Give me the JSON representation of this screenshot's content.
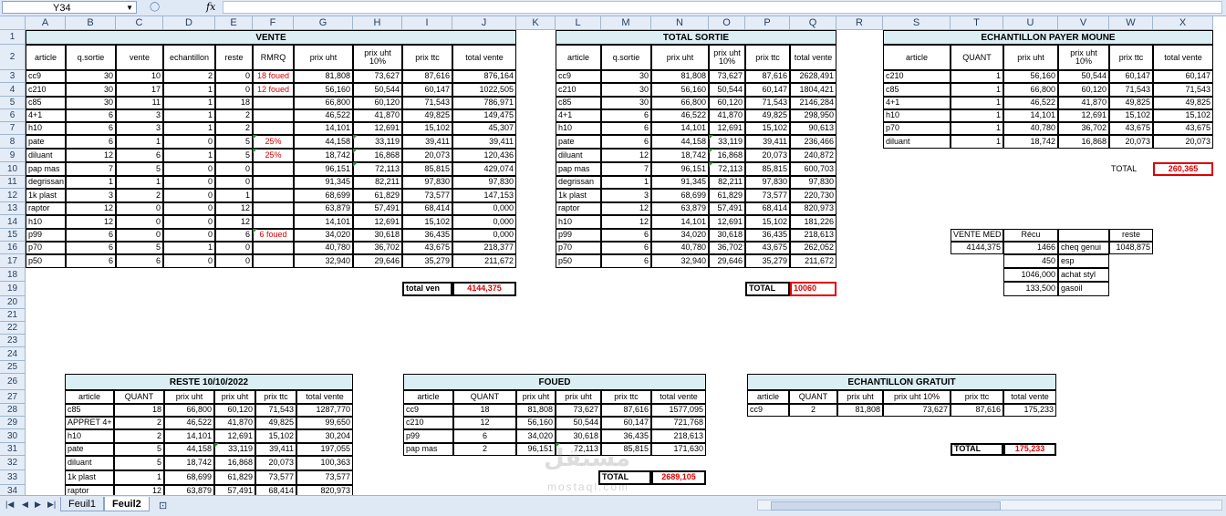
{
  "formula_bar": {
    "name_box": "Y34",
    "fx": "fx"
  },
  "columns": [
    "A",
    "B",
    "C",
    "D",
    "E",
    "F",
    "G",
    "H",
    "I",
    "J",
    "K",
    "L",
    "M",
    "N",
    "O",
    "P",
    "Q",
    "R",
    "S",
    "T",
    "U",
    "V",
    "W",
    "X"
  ],
  "rows": [
    "1",
    "2",
    "3",
    "4",
    "5",
    "6",
    "7",
    "8",
    "9",
    "10",
    "11",
    "12",
    "13",
    "14",
    "15",
    "16",
    "17",
    "18",
    "19",
    "20",
    "21",
    "22",
    "23",
    "24",
    "25",
    "26",
    "27",
    "28",
    "29",
    "30",
    "31",
    "32",
    "33",
    "34"
  ],
  "vente": {
    "title": "VENTE",
    "headers": [
      "article",
      "q.sortie",
      "vente",
      "echantillon",
      "reste",
      "RMRQ",
      "prix uht",
      "prix uht 10%",
      "prix ttc",
      "total vente"
    ],
    "rows": [
      [
        "cc9",
        "30",
        "10",
        "2",
        "0",
        "18 foued",
        "81,808",
        "73,627",
        "87,616",
        "876,164"
      ],
      [
        "c210",
        "30",
        "17",
        "1",
        "0",
        "12 foued",
        "56,160",
        "50,544",
        "60,147",
        "1022,505"
      ],
      [
        "c85",
        "30",
        "11",
        "1",
        "18",
        "",
        "66,800",
        "60,120",
        "71,543",
        "786,971"
      ],
      [
        "4+1",
        "6",
        "3",
        "1",
        "2",
        "",
        "46,522",
        "41,870",
        "49,825",
        "149,475"
      ],
      [
        "h10",
        "6",
        "3",
        "1",
        "2",
        "",
        "14,101",
        "12,691",
        "15,102",
        "45,307"
      ],
      [
        "pate",
        "6",
        "1",
        "0",
        "5",
        "25%",
        "44,158",
        "33,119",
        "39,411",
        "39,411"
      ],
      [
        "diluant",
        "12",
        "6",
        "1",
        "5",
        "25%",
        "18,742",
        "16,868",
        "20,073",
        "120,436"
      ],
      [
        "pap mas",
        "7",
        "5",
        "0",
        "0",
        "",
        "96,151",
        "72,113",
        "85,815",
        "429,074"
      ],
      [
        "degrissan",
        "1",
        "1",
        "0",
        "0",
        "",
        "91,345",
        "82,211",
        "97,830",
        "97,830"
      ],
      [
        "1k plast",
        "3",
        "2",
        "0",
        "1",
        "",
        "68,699",
        "61,829",
        "73,577",
        "147,153"
      ],
      [
        "raptor",
        "12",
        "0",
        "0",
        "12",
        "",
        "63,879",
        "57,491",
        "68,414",
        "0,000"
      ],
      [
        "h10",
        "12",
        "0",
        "0",
        "12",
        "",
        "14,101",
        "12,691",
        "15,102",
        "0,000"
      ],
      [
        "p99",
        "6",
        "0",
        "0",
        "6",
        "6 foued",
        "34,020",
        "30,618",
        "36,435",
        "0,000"
      ],
      [
        "p70",
        "6",
        "5",
        "1",
        "0",
        "",
        "40,780",
        "36,702",
        "43,675",
        "218,377"
      ],
      [
        "p50",
        "6",
        "6",
        "0",
        "0",
        "",
        "32,940",
        "29,646",
        "35,279",
        "211,672"
      ]
    ],
    "total_label": "total ven",
    "total_value": "4144,375"
  },
  "total_sortie": {
    "title": "TOTAL SORTIE",
    "headers": [
      "article",
      "q.sortie",
      "prix uht",
      "prix uht 10%",
      "prix ttc",
      "total vente"
    ],
    "rows": [
      [
        "cc9",
        "30",
        "81,808",
        "73,627",
        "87,616",
        "2628,491"
      ],
      [
        "c210",
        "30",
        "56,160",
        "50,544",
        "60,147",
        "1804,421"
      ],
      [
        "c85",
        "30",
        "66,800",
        "60,120",
        "71,543",
        "2146,284"
      ],
      [
        "4+1",
        "6",
        "46,522",
        "41,870",
        "49,825",
        "298,950"
      ],
      [
        "h10",
        "6",
        "14,101",
        "12,691",
        "15,102",
        "90,613"
      ],
      [
        "pate",
        "6",
        "44,158",
        "33,119",
        "39,411",
        "236,466"
      ],
      [
        "diluant",
        "12",
        "18,742",
        "16,868",
        "20,073",
        "240,872"
      ],
      [
        "pap mas",
        "7",
        "96,151",
        "72,113",
        "85,815",
        "600,703"
      ],
      [
        "degrissan",
        "1",
        "91,345",
        "82,211",
        "97,830",
        "97,830"
      ],
      [
        "1k plast",
        "3",
        "68,699",
        "61,829",
        "73,577",
        "220,730"
      ],
      [
        "raptor",
        "12",
        "63,879",
        "57,491",
        "68,414",
        "820,973"
      ],
      [
        "h10",
        "12",
        "14,101",
        "12,691",
        "15,102",
        "181,226"
      ],
      [
        "p99",
        "6",
        "34,020",
        "30,618",
        "36,435",
        "218,613"
      ],
      [
        "p70",
        "6",
        "40,780",
        "36,702",
        "43,675",
        "262,052"
      ],
      [
        "p50",
        "6",
        "32,940",
        "29,646",
        "35,279",
        "211,672"
      ]
    ],
    "total_label": "TOTAL",
    "total_value": "10060"
  },
  "echantillon_payer": {
    "title": "ECHANTILLON PAYER MOUNE",
    "headers": [
      "article",
      "QUANT",
      "prix uht",
      "prix uht 10%",
      "prix ttc",
      "total vente"
    ],
    "rows": [
      [
        "c210",
        "1",
        "56,160",
        "50,544",
        "60,147",
        "60,147"
      ],
      [
        "c85",
        "1",
        "66,800",
        "60,120",
        "71,543",
        "71,543"
      ],
      [
        "4+1",
        "1",
        "46,522",
        "41,870",
        "49,825",
        "49,825"
      ],
      [
        "h10",
        "1",
        "14,101",
        "12,691",
        "15,102",
        "15,102"
      ],
      [
        "p70",
        "1",
        "40,780",
        "36,702",
        "43,675",
        "43,675"
      ],
      [
        "diluant",
        "1",
        "18,742",
        "16,868",
        "20,073",
        "20,073"
      ]
    ],
    "total_label": "TOTAL",
    "total_value": "260,365"
  },
  "recu": {
    "vente_med_label": "VENTE MED",
    "recu_label": "Récu",
    "reste_label": "reste",
    "vente_med_value": "4144,375",
    "reste_value": "1048,875",
    "items": [
      [
        "1466",
        "cheq genui"
      ],
      [
        "450",
        "esp"
      ],
      [
        "1046,000",
        "achat styl"
      ],
      [
        "133,500",
        "gasoil"
      ]
    ]
  },
  "reste": {
    "title": "RESTE 10/10/2022",
    "headers": [
      "article",
      "QUANT",
      "prix uht",
      "prix uht",
      "prix ttc",
      "total vente"
    ],
    "rows": [
      [
        "c85",
        "18",
        "66,800",
        "60,120",
        "71,543",
        "1287,770"
      ],
      [
        "APPRET 4+",
        "2",
        "46,522",
        "41,870",
        "49,825",
        "99,650"
      ],
      [
        "h10",
        "2",
        "14,101",
        "12,691",
        "15,102",
        "30,204"
      ],
      [
        "pate",
        "5",
        "44,158",
        "33,119",
        "39,411",
        "197,055"
      ],
      [
        "diluant",
        "5",
        "18,742",
        "16,868",
        "20,073",
        "100,363"
      ],
      [
        "1k plast",
        "1",
        "68,699",
        "61,829",
        "73,577",
        "73,577"
      ],
      [
        "raptor",
        "12",
        "63,879",
        "57,491",
        "68,414",
        "820,973"
      ]
    ]
  },
  "foued": {
    "title": "FOUED",
    "headers": [
      "article",
      "QUANT",
      "prix uht",
      "prix uht",
      "prix ttc",
      "total vente"
    ],
    "rows": [
      [
        "cc9",
        "18",
        "81,808",
        "73,627",
        "87,616",
        "1577,095"
      ],
      [
        "c210",
        "12",
        "56,160",
        "50,544",
        "60,147",
        "721,768"
      ],
      [
        "p99",
        "6",
        "34,020",
        "30,618",
        "36,435",
        "218,613"
      ],
      [
        "pap mas",
        "2",
        "96,151",
        "72,113",
        "85,815",
        "171,630"
      ]
    ],
    "total_label": "TOTAL",
    "total_value": "2689,105"
  },
  "echantillon_gratuit": {
    "title": "ECHANTILLON GRATUIT",
    "headers": [
      "article",
      "QUANT",
      "prix uht",
      "prix uht 10%",
      "prix ttc",
      "total vente"
    ],
    "rows": [
      [
        "cc9",
        "2",
        "81,808",
        "73,627",
        "87,616",
        "175,233"
      ]
    ],
    "total_label": "TOTAL",
    "total_value": "175,233"
  },
  "sheets": {
    "tab1": "Feuil1",
    "tab2": "Feuil2"
  },
  "watermark": {
    "main": "مستقل",
    "sub": "mostaql.com"
  }
}
